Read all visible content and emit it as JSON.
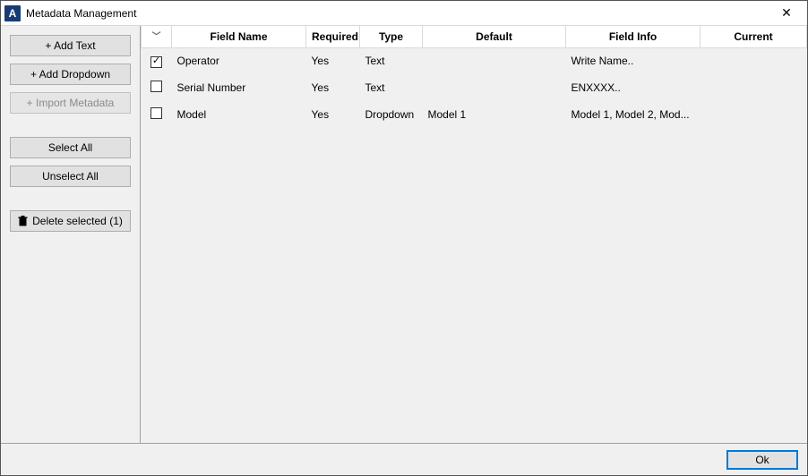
{
  "window": {
    "title": "Metadata Management",
    "app_icon_letter": "A"
  },
  "sidebar": {
    "add_text_label": "+ Add Text",
    "add_dropdown_label": "+ Add Dropdown",
    "import_metadata_label": "+ Import Metadata",
    "select_all_label": "Select All",
    "unselect_all_label": "Unselect All",
    "delete_selected_label": "Delete selected (1)"
  },
  "table": {
    "columns": {
      "checkbox": "",
      "field_name": "Field Name",
      "required": "Required",
      "type": "Type",
      "default": "Default",
      "field_info": "Field Info",
      "current": "Current"
    },
    "rows": [
      {
        "checked": true,
        "field_name": "Operator",
        "required": "Yes",
        "type": "Text",
        "default": "",
        "field_info": "Write Name..",
        "current": ""
      },
      {
        "checked": false,
        "field_name": "Serial Number",
        "required": "Yes",
        "type": "Text",
        "default": "",
        "field_info": "ENXXXX..",
        "current": ""
      },
      {
        "checked": false,
        "field_name": "Model",
        "required": "Yes",
        "type": "Dropdown",
        "default": "Model 1",
        "field_info": "Model 1, Model 2, Mod...",
        "current": ""
      }
    ]
  },
  "footer": {
    "ok_label": "Ok"
  }
}
